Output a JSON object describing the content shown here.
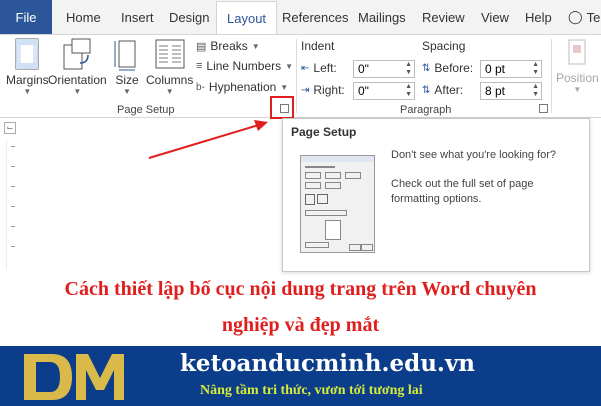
{
  "tabs": {
    "file": "File",
    "home": "Home",
    "insert": "Insert",
    "design": "Design",
    "layout": "Layout",
    "references": "References",
    "mailings": "Mailings",
    "review": "Review",
    "view": "View",
    "help": "Help",
    "tell_me": "Te"
  },
  "ribbon": {
    "margins": "Margins",
    "orientation": "Orientation",
    "size": "Size",
    "columns": "Columns",
    "breaks": "Breaks",
    "line_numbers": "Line Numbers",
    "hyphenation": "Hyphenation",
    "page_setup_group": "Page Setup",
    "indent_label": "Indent",
    "left_label": "Left:",
    "left_value": "0\"",
    "right_label": "Right:",
    "right_value": "0\"",
    "spacing_label": "Spacing",
    "before_label": "Before:",
    "before_value": "0 pt",
    "after_label": "After:",
    "after_value": "8 pt",
    "paragraph_group": "Paragraph",
    "position": "Position"
  },
  "popup": {
    "title": "Page Setup",
    "line1": "Don't see what you're looking for?",
    "line2": "Check out the full set of page formatting options."
  },
  "caption": {
    "line1": "Cách thiết lập bố cục nội dung trang trên Word chuyên",
    "line2": "nghiệp và đẹp mắt"
  },
  "banner": {
    "site": "ketoanducminh.edu.vn",
    "tagline": "Nâng tầm tri thức, vươn tới tương lai"
  },
  "colors": {
    "file_tab": "#2b579a",
    "caption": "#e01e1e",
    "banner": "#0b3d8a",
    "tagline": "#d6ec3a",
    "highlight_box": "#e01e1e"
  }
}
